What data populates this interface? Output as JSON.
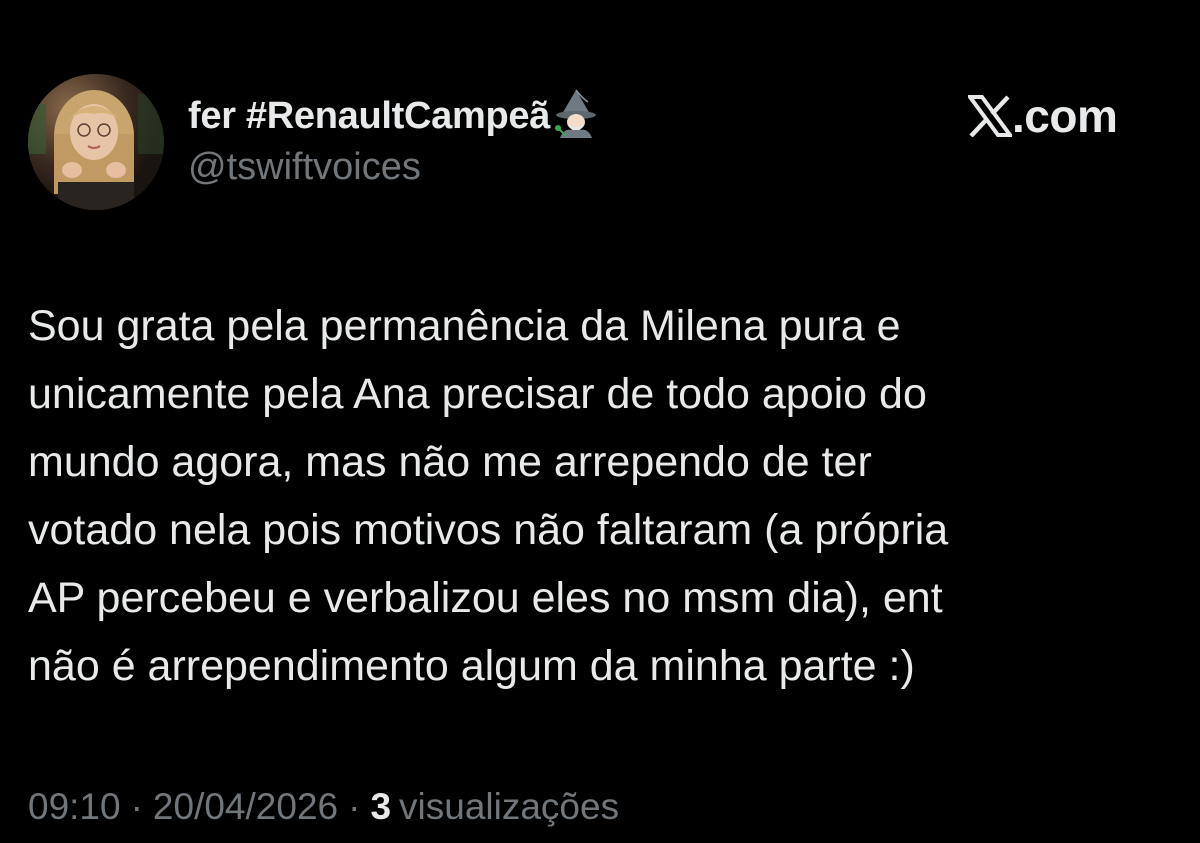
{
  "author": {
    "display_name": "fer #RenaultCampeã",
    "handle": "@tswiftvoices",
    "badge_emoji_icon": "mage-emoji-icon"
  },
  "brand": {
    "logo_icon": "x-logo-icon",
    "text": ".com"
  },
  "tweet": {
    "lines": [
      "Sou grata pela permanência da Milena pura e",
      "unicamente pela Ana precisar de todo apoio do",
      "mundo agora, mas não me arrependo de ter",
      "votado nela pois motivos não faltaram (a própria",
      "AP percebeu e verbalizou eles no msm dia), ent",
      "não é arrependimento algum da minha parte :)"
    ]
  },
  "meta": {
    "time": "09:10",
    "separator": "·",
    "date": "20/04/2026",
    "views_count": "3",
    "views_label": "visualizações"
  },
  "colors": {
    "background": "#000000",
    "primary_text": "#e7e9ea",
    "secondary_text": "#71767b"
  }
}
